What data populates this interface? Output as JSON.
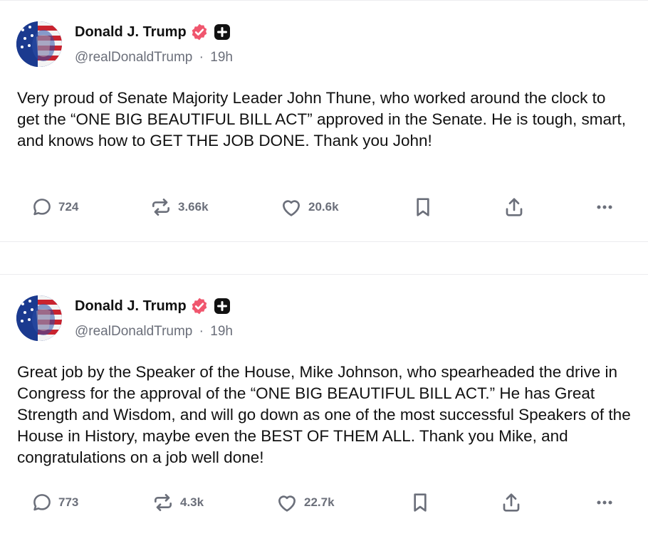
{
  "posts": [
    {
      "author": {
        "name": "Donald J. Trump",
        "handle": "@realDonaldTrump",
        "time": "19h"
      },
      "body": "Very proud of Senate Majority Leader John Thune, who worked around the clock to get the “ONE BIG BEAUTIFUL BILL ACT” approved in the Senate. He is tough, smart, and knows how to GET THE JOB DONE. Thank you John!",
      "stats": {
        "replies": "724",
        "reposts": "3.66k",
        "likes": "20.6k"
      }
    },
    {
      "author": {
        "name": "Donald J. Trump",
        "handle": "@realDonaldTrump",
        "time": "19h"
      },
      "body": "Great job by the Speaker of the House, Mike Johnson, who spearheaded the drive in Congress for the approval of the “ONE BIG BEAUTIFUL BILL ACT.” He has Great Strength and Wisdom, and will go down as one of the most successful Speakers of the House in History, maybe even the BEST OF THEM ALL. Thank you Mike, and congratulations on a job well done!",
      "stats": {
        "replies": "773",
        "reposts": "4.3k",
        "likes": "22.7k"
      }
    }
  ],
  "meta": {
    "separator": "·"
  },
  "colors": {
    "verified": "#f0566e",
    "muted": "#6b6f7a",
    "text": "#111111",
    "border": "#ececef"
  },
  "icons": [
    "verified-badge-icon",
    "plus-badge-icon",
    "reply-icon",
    "repost-icon",
    "like-icon",
    "bookmark-icon",
    "share-icon",
    "more-icon"
  ]
}
